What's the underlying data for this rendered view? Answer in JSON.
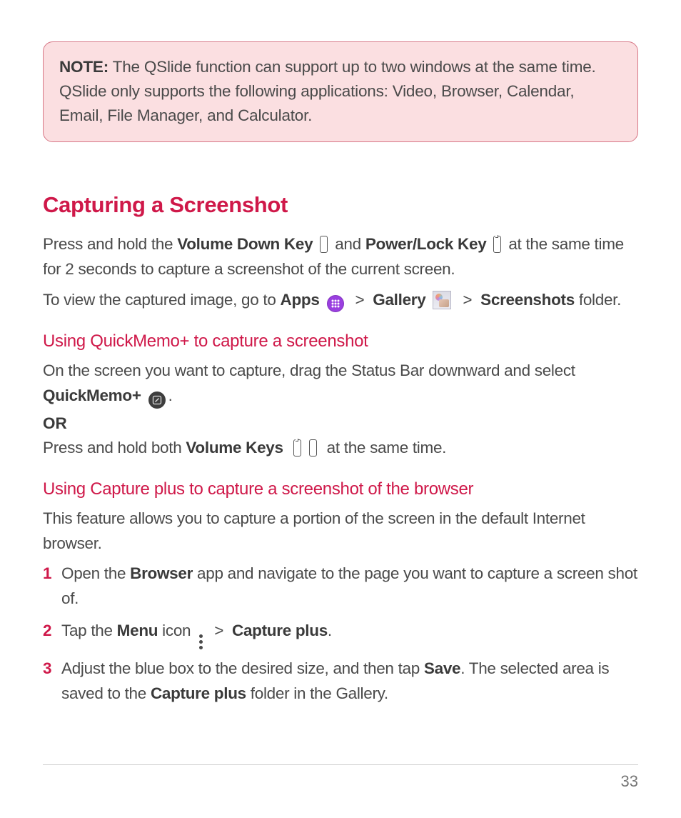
{
  "note": {
    "label": "NOTE:",
    "text": " The QSlide function can support up to two windows at the same time. QSlide only supports the following applications: Video, Browser, Calendar, Email, File Manager, and Calculator."
  },
  "section_title": "Capturing a Screenshot",
  "p1": {
    "a": "Press and hold the ",
    "vdk": "Volume Down Key",
    "b": " and ",
    "plk": "Power/Lock Key",
    "c": " at the same time for 2 seconds to capture a screenshot of the current screen."
  },
  "p2": {
    "a": "To view the captured image, go to ",
    "apps": "Apps",
    "gt1": ">",
    "gallery": "Gallery",
    "gt2": ">",
    "ss": "Screenshots",
    "b": " folder."
  },
  "sub1": "Using QuickMemo+ to capture a screenshot",
  "qm": {
    "a": "On the screen you want to capture, drag the Status Bar downward and select ",
    "qmp": "QuickMemo+",
    "dot": "."
  },
  "or": "OR",
  "qm2": {
    "a": "Press and hold both ",
    "vk": "Volume Keys",
    "b": " at the same time."
  },
  "sub2": "Using Capture plus to capture a screenshot of the browser",
  "cp_intro": "This feature allows you to capture a portion of the screen in the default Internet browser.",
  "steps": {
    "n1": "1",
    "s1a": "Open the ",
    "s1b": "Browser",
    "s1c": " app and navigate to the page you want to capture a screen shot of.",
    "n2": "2",
    "s2a": "Tap the ",
    "s2b": "Menu",
    "s2c": " icon ",
    "s2gt": ">",
    "s2d": "Capture plus",
    "s2e": ".",
    "n3": "3",
    "s3a": "Adjust the blue box to the desired size, and then tap ",
    "s3b": "Save",
    "s3c": ". The selected area is saved to the ",
    "s3d": "Capture plus",
    "s3e": " folder in the Gallery."
  },
  "page_number": "33"
}
